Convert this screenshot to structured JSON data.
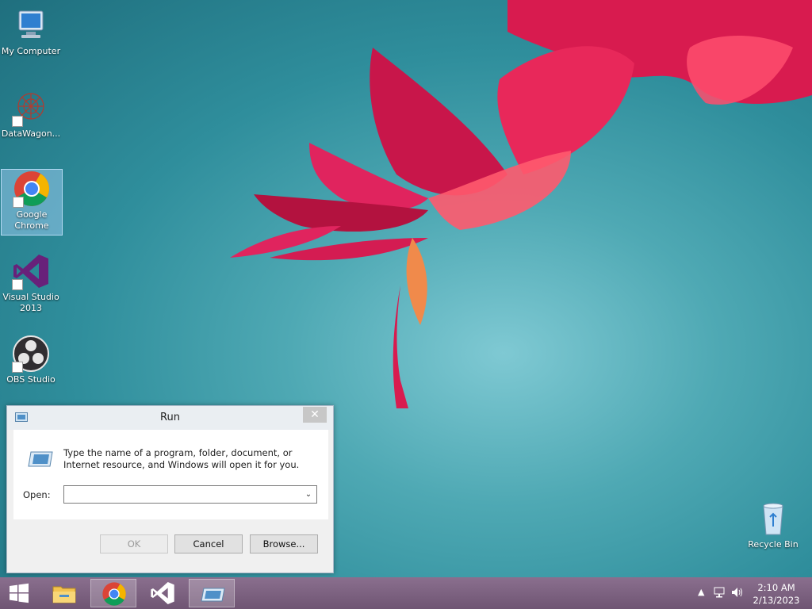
{
  "desktop": {
    "icons": [
      {
        "label": "My Computer",
        "icon": "computer-icon",
        "shortcut": false,
        "selected": false
      },
      {
        "label": "DataWagon...",
        "icon": "datawagon-icon",
        "shortcut": true,
        "selected": false
      },
      {
        "label": "Google Chrome",
        "icon": "chrome-icon",
        "shortcut": true,
        "selected": true
      },
      {
        "label": "Visual Studio 2013",
        "icon": "visual-studio-icon",
        "shortcut": true,
        "selected": false
      },
      {
        "label": "OBS Studio",
        "icon": "obs-icon",
        "shortcut": true,
        "selected": false
      }
    ],
    "recycle_bin": {
      "label": "Recycle Bin",
      "icon": "recycle-bin-icon"
    }
  },
  "run_dialog": {
    "title": "Run",
    "close_glyph": "✕",
    "description": "Type the name of a program, folder, document, or Internet resource, and Windows will open it for you.",
    "open_label": "Open:",
    "open_value": "",
    "buttons": {
      "ok": "OK",
      "cancel": "Cancel",
      "browse": "Browse..."
    },
    "ok_enabled": false
  },
  "taskbar": {
    "apps": [
      {
        "name": "file-explorer",
        "icon": "folder-icon",
        "active": false
      },
      {
        "name": "chrome",
        "icon": "chrome-icon",
        "active": true
      },
      {
        "name": "visual-studio",
        "icon": "visual-studio-icon",
        "active": false
      },
      {
        "name": "run",
        "icon": "run-icon",
        "active": true
      }
    ],
    "clock": {
      "time": "2:10 AM",
      "date": "2/13/2023"
    }
  },
  "colors": {
    "wallpaper": "#3a98a6",
    "flower": "#e0245e",
    "taskbar": "#7a5f7e",
    "vs_purple": "#68217a"
  }
}
